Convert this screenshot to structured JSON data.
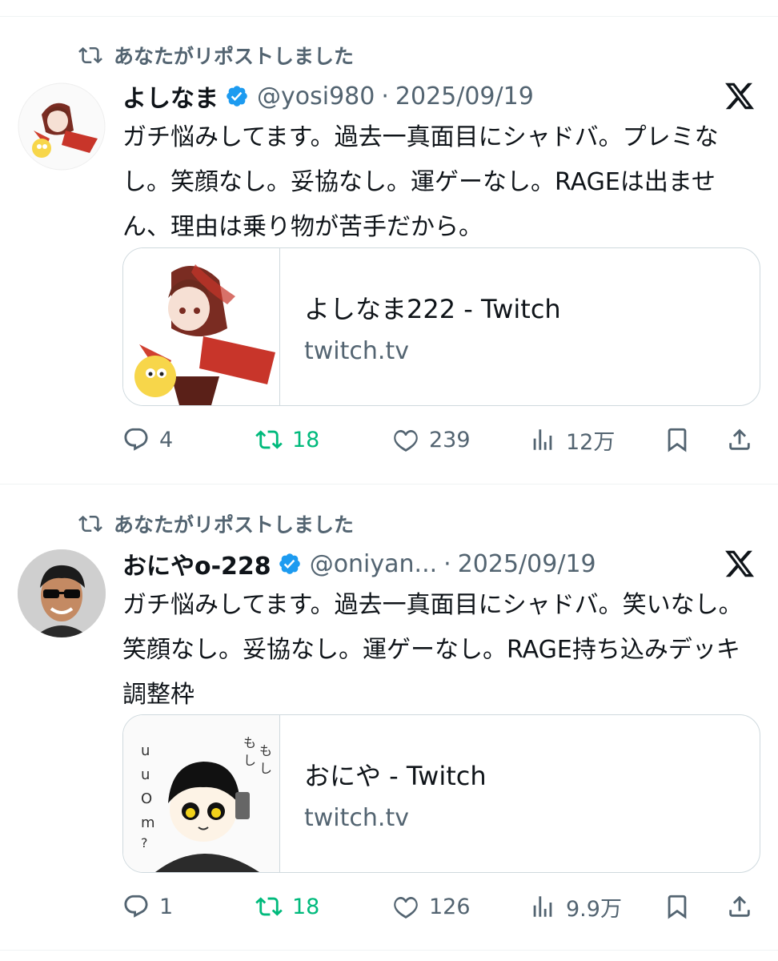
{
  "tweets": [
    {
      "repost_label": "あなたがリポストしました",
      "name": "よしなま",
      "handle": "@yosi980",
      "separator": "·",
      "date": "2025/09/19",
      "text": "ガチ悩みしてます。過去一真面目にシャドバ。プレミなし。笑顔なし。妥協なし。運ゲーなし。RAGEは出ません、理由は乗り物が苦手だから。",
      "card": {
        "title": "よしなま222 - Twitch",
        "domain": "twitch.tv"
      },
      "stats": {
        "replies": "4",
        "reposts": "18",
        "likes": "239",
        "views": "12万"
      }
    },
    {
      "repost_label": "あなたがリポストしました",
      "name": "おにやo-228",
      "handle": "@oniyan...",
      "separator": "·",
      "date": "2025/09/19",
      "text": "ガチ悩みしてます。過去一真面目にシャドバ。笑いなし。笑顔なし。妥協なし。運ゲーなし。RAGE持ち込みデッキ調整枠",
      "card": {
        "title": "おにや - Twitch",
        "domain": "twitch.tv"
      },
      "stats": {
        "replies": "1",
        "reposts": "18",
        "likes": "126",
        "views": "9.9万"
      }
    }
  ],
  "colors": {
    "verified": "#1d9bf0",
    "repost_active": "#00ba7c",
    "muted": "#536471",
    "border": "#cfd9de"
  },
  "icons": [
    "repost-icon",
    "verified-badge-icon",
    "x-logo-icon",
    "reply-icon",
    "like-icon",
    "views-icon",
    "bookmark-icon",
    "share-icon"
  ]
}
